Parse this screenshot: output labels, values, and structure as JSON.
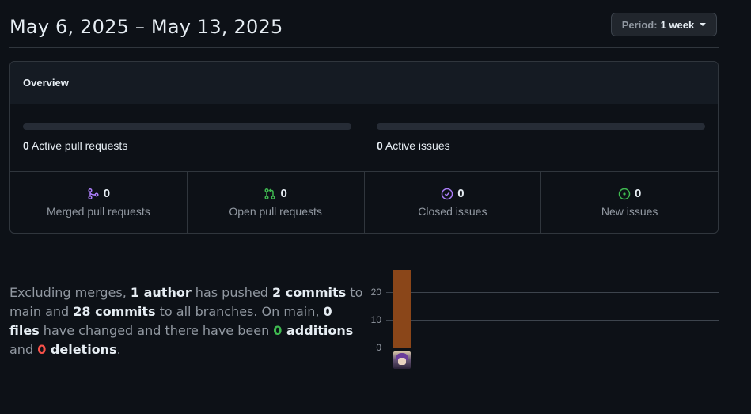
{
  "header": {
    "date_range": "May 6, 2025 – May 13, 2025",
    "period_label": "Period:",
    "period_value": "1 week"
  },
  "overview": {
    "title": "Overview",
    "active_prs": {
      "count": "0",
      "label": "Active pull requests"
    },
    "active_issues": {
      "count": "0",
      "label": "Active issues"
    },
    "stats": [
      {
        "icon": "merge-icon",
        "count": "0",
        "label": "Merged pull requests",
        "color": "#ab7df8"
      },
      {
        "icon": "pull-request-icon",
        "count": "0",
        "label": "Open pull requests",
        "color": "#3fb950"
      },
      {
        "icon": "issue-closed-icon",
        "count": "0",
        "label": "Closed issues",
        "color": "#ab7df8"
      },
      {
        "icon": "issue-open-icon",
        "count": "0",
        "label": "New issues",
        "color": "#3fb950"
      }
    ]
  },
  "summary": {
    "t1": "Excluding merges, ",
    "authors": "1 author",
    "t2": " has pushed ",
    "commits": "2 commits",
    "t3": " to main and ",
    "all_commits": "28 commits",
    "t4": " to all branches. On main, ",
    "files": "0 files",
    "t5": " have changed and there have been ",
    "additions_num": "0",
    "additions_word": " additions",
    "t6": " and ",
    "deletions_num": "0",
    "deletions_word": " deletions",
    "t7": "."
  },
  "chart_data": {
    "type": "bar",
    "categories": [
      "author-1"
    ],
    "values": [
      28
    ],
    "ylim": [
      0,
      28
    ],
    "yticks": [
      0,
      10,
      20
    ],
    "bar_color": "#8a4619",
    "grid": true
  }
}
